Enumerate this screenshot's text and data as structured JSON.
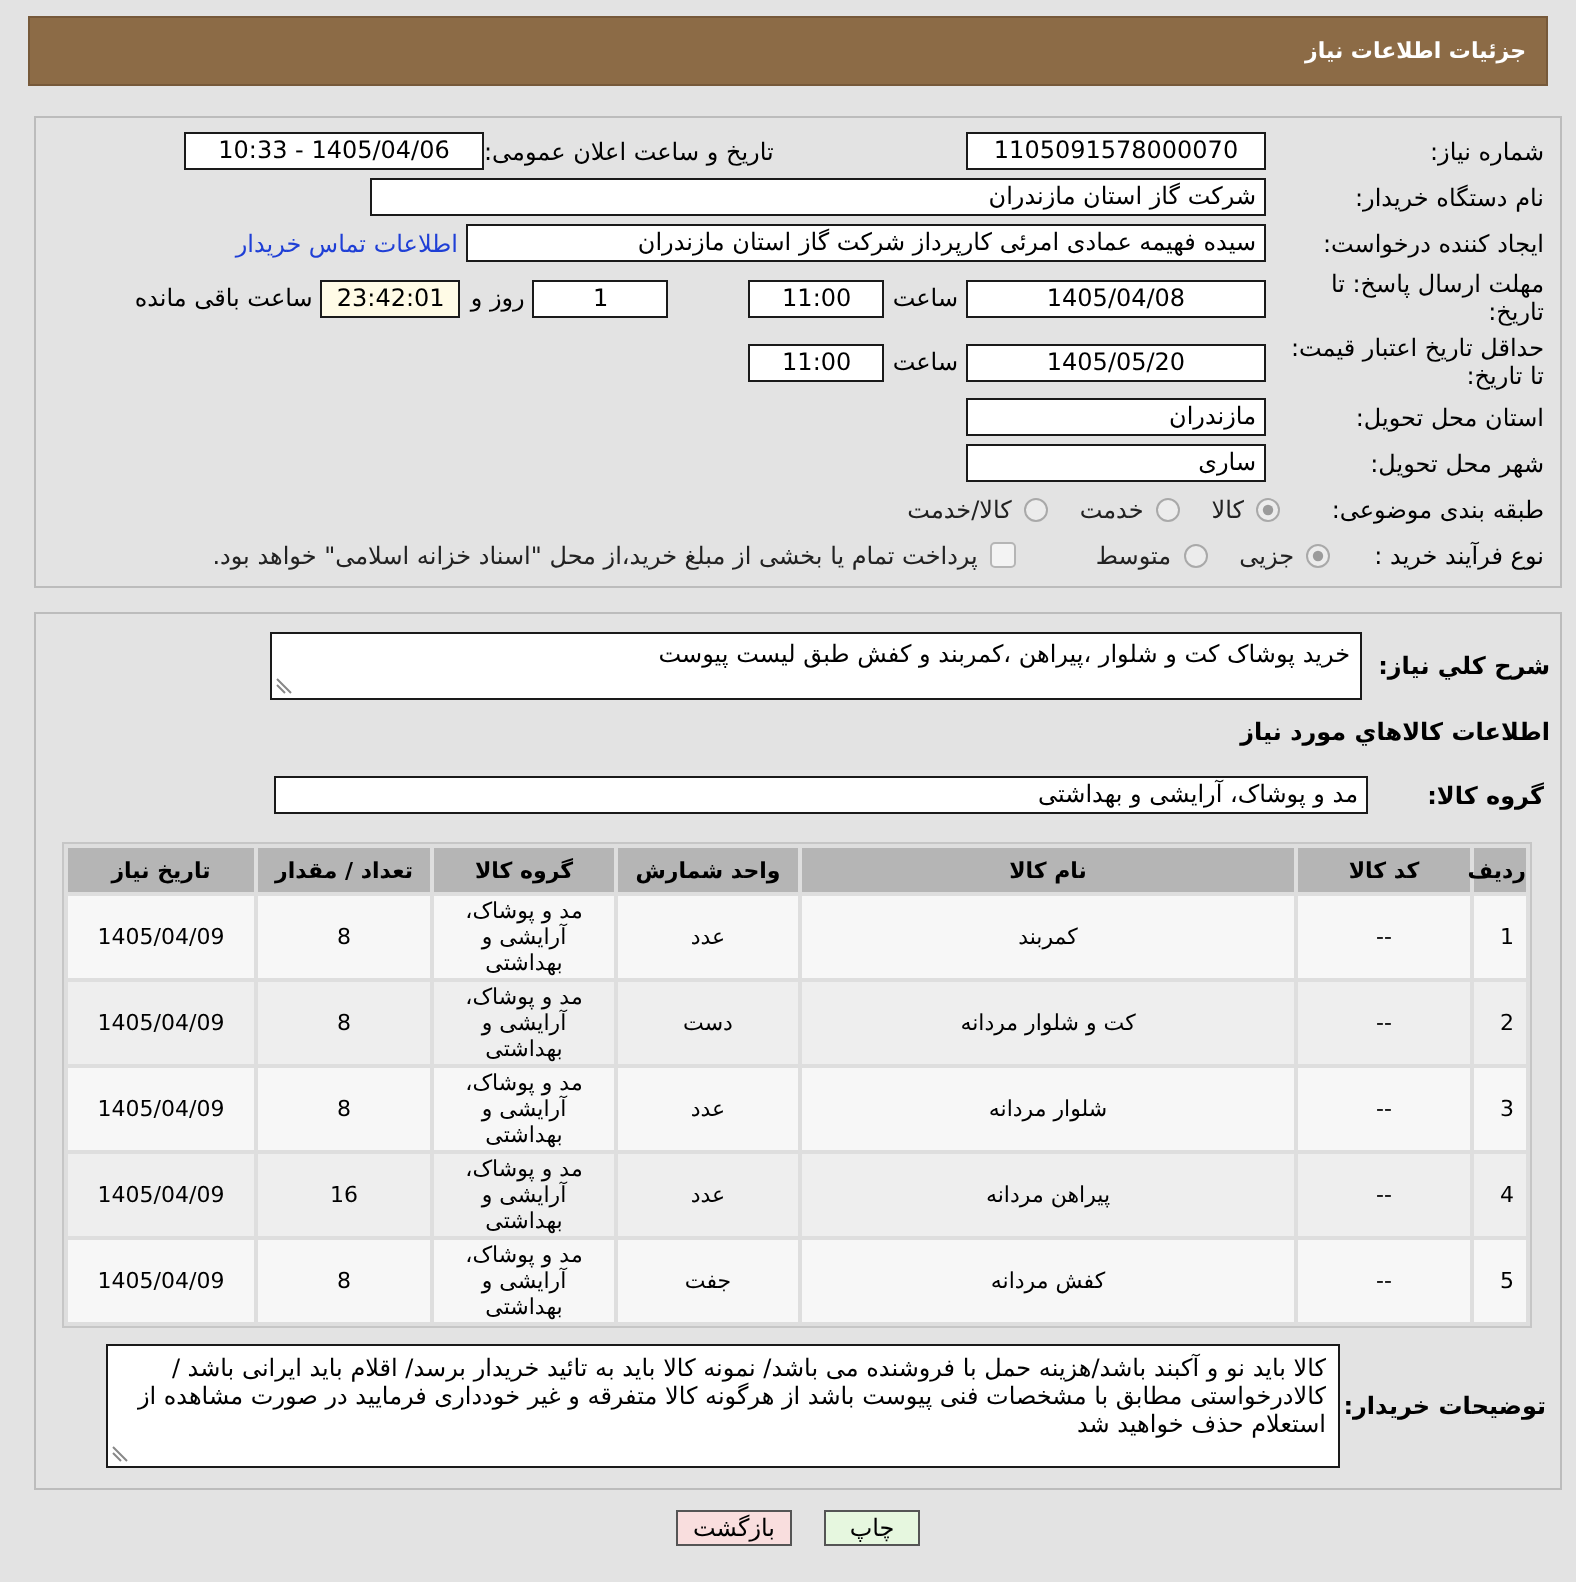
{
  "header": {
    "title": "جزئیات اطلاعات نیاز"
  },
  "details": {
    "need_number": {
      "label": "شماره نیاز:",
      "value": "1105091578000070"
    },
    "announce": {
      "label": "تاریخ و ساعت اعلان عمومی:",
      "value": "1405/04/06 - 10:33"
    },
    "buyer_org": {
      "label": "نام دستگاه خریدار:",
      "value": "شرکت گاز استان مازندران"
    },
    "requester": {
      "label": "ایجاد کننده درخواست:",
      "value": "سیده فهیمه عمادی امرئی کارپرداز شرکت گاز استان مازندران",
      "contact_link": "اطلاعات تماس خریدار"
    },
    "response_deadline": {
      "label": "مهلت ارسال پاسخ: تا تاریخ:",
      "date": "1405/04/08",
      "time_label": "ساعت",
      "time": "11:00",
      "days": "1",
      "days_label": "روز و",
      "remaining": "23:42:01",
      "remaining_label": "ساعت باقی مانده"
    },
    "price_validity": {
      "label": "حداقل تاریخ اعتبار قیمت: تا تاریخ:",
      "date": "1405/05/20",
      "time_label": "ساعت",
      "time": "11:00"
    },
    "delivery_province": {
      "label": "استان محل تحویل:",
      "value": "مازندران"
    },
    "delivery_city": {
      "label": "شهر محل تحویل:",
      "value": "ساری"
    },
    "subject_category": {
      "label": "طبقه بندی موضوعی:",
      "options": [
        {
          "label": "کالا",
          "selected": true
        },
        {
          "label": "خدمت",
          "selected": false
        },
        {
          "label": "کالا/خدمت",
          "selected": false
        }
      ]
    },
    "purchase_process": {
      "label": "نوع فرآیند خرید :",
      "options": [
        {
          "label": "جزیی",
          "selected": true
        },
        {
          "label": "متوسط",
          "selected": false
        }
      ],
      "treasury_payment": {
        "label": "پرداخت تمام یا بخشی از مبلغ خرید،از محل \"اسناد خزانه اسلامی\" خواهد بود.",
        "checked": false
      }
    }
  },
  "need": {
    "summary_label": "شرح کلي نیاز:",
    "summary": "خرید پوشاک کت و شلوار ،پیراهن ،کمربند و کفش طبق لیست پیوست",
    "goods_heading": "اطلاعات کالاهاي مورد نیاز",
    "group_label": "گروه کالا:",
    "group": "مد و پوشاک، آرایشی و بهداشتی"
  },
  "table": {
    "columns": [
      "ردیف",
      "کد کالا",
      "نام کالا",
      "واحد شمارش",
      "گروه کالا",
      "تعداد / مقدار",
      "تاریخ نیاز"
    ],
    "rows": [
      [
        "1",
        "--",
        "کمربند",
        "عدد",
        "مد و پوشاک، آرایشی و بهداشتی",
        "8",
        "1405/04/09"
      ],
      [
        "2",
        "--",
        "کت و شلوار مردانه",
        "دست",
        "مد و پوشاک، آرایشی و بهداشتی",
        "8",
        "1405/04/09"
      ],
      [
        "3",
        "--",
        "شلوار مردانه",
        "عدد",
        "مد و پوشاک، آرایشی و بهداشتی",
        "8",
        "1405/04/09"
      ],
      [
        "4",
        "--",
        "پیراهن مردانه",
        "عدد",
        "مد و پوشاک، آرایشی و بهداشتی",
        "16",
        "1405/04/09"
      ],
      [
        "5",
        "--",
        "کفش مردانه",
        "جفت",
        "مد و پوشاک، آرایشی و بهداشتی",
        "8",
        "1405/04/09"
      ]
    ]
  },
  "buyer_notes": {
    "label": "توضیحات خریدار:",
    "text": "کالا باید نو و آکبند باشد/هزینه حمل با فروشنده می باشد/ نمونه کالا باید به تائید خریدار برسد/ اقلام باید ایرانی باشد / کالادرخواستی مطابق با مشخصات فنی پیوست باشد از هرگونه کالا متفرقه و غیر خودداری فرمایید در صورت مشاهده از استعلام حذف خواهید شد"
  },
  "buttons": [
    {
      "label": "چاپ",
      "kind": "print"
    },
    {
      "label": "بازگشت",
      "kind": "back"
    }
  ]
}
